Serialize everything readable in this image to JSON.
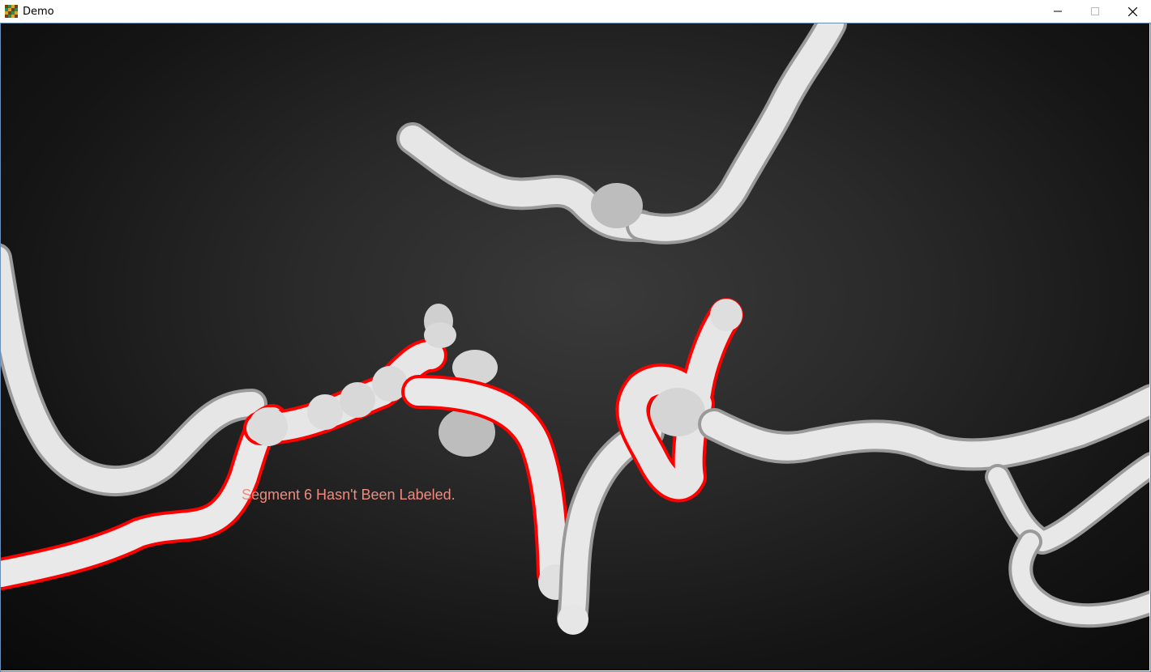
{
  "window": {
    "title": "Demo",
    "controls": {
      "minimize_icon": "minimize-icon",
      "maximize_icon": "maximize-icon",
      "close_icon": "close-icon"
    }
  },
  "viewport": {
    "status_message": "Segment 6 Hasn't Been Labeled.",
    "colors": {
      "tube": "#e6e6e6",
      "highlight": "#ff0000",
      "label": "#f08a7e",
      "background_center": "#3a3a3a",
      "background_edge": "#0a0a0a"
    }
  }
}
